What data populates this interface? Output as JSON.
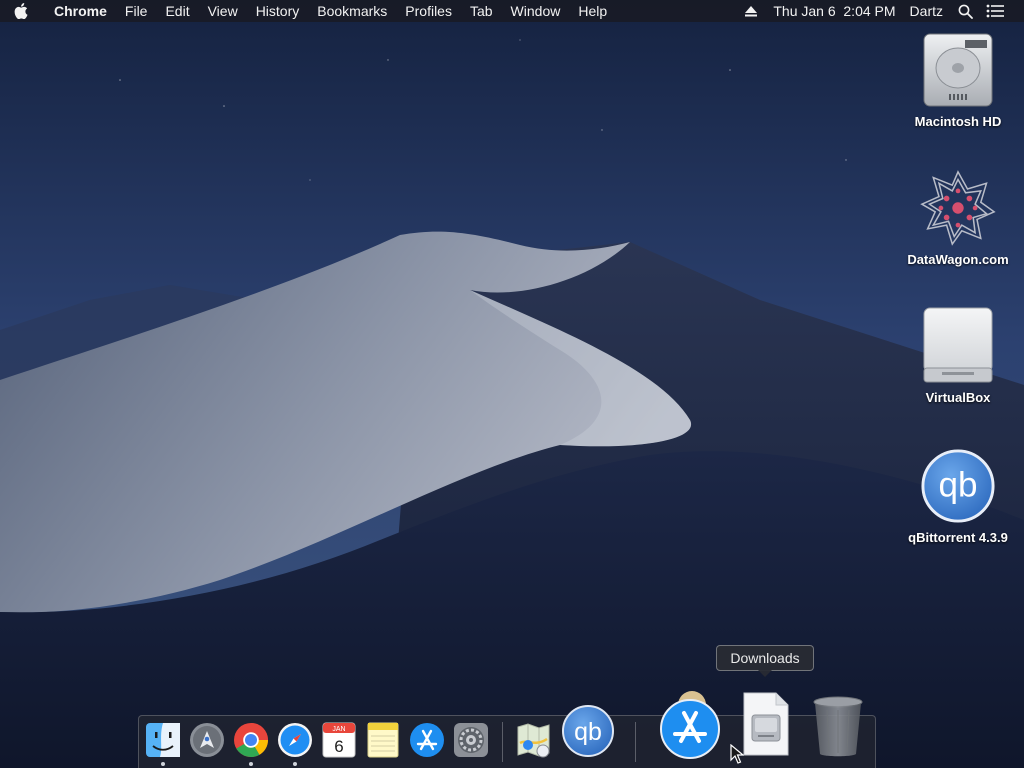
{
  "menubar": {
    "apple_icon": "apple-logo-icon",
    "app_name": "Chrome",
    "menus": [
      "File",
      "Edit",
      "View",
      "History",
      "Bookmarks",
      "Profiles",
      "Tab",
      "Window",
      "Help"
    ],
    "clock": "Thu Jan 6  2:04 PM",
    "user": "Dartz",
    "status_icons": [
      "eject-icon",
      "spotlight-search-icon",
      "notification-center-icon"
    ]
  },
  "desktop": {
    "icons": [
      {
        "label": "Macintosh HD",
        "icon": "hard-drive-icon"
      },
      {
        "label": "DataWagon.com",
        "icon": "datawagon-star-icon"
      },
      {
        "label": "VirtualBox",
        "icon": "external-disk-icon"
      },
      {
        "label": "qBittorrent 4.3.9",
        "icon": "qbittorrent-icon",
        "glyph": "qb"
      }
    ]
  },
  "dock": {
    "apps": [
      {
        "name": "Finder",
        "icon": "finder-icon",
        "running": true
      },
      {
        "name": "Launchpad",
        "icon": "launchpad-icon",
        "running": false
      },
      {
        "name": "Google Chrome",
        "icon": "chrome-icon",
        "running": true
      },
      {
        "name": "Safari",
        "icon": "safari-icon",
        "running": true
      },
      {
        "name": "Calendar",
        "icon": "calendar-icon",
        "running": false,
        "month": "JAN",
        "day": "6"
      },
      {
        "name": "Notes",
        "icon": "notes-icon",
        "running": false
      },
      {
        "name": "App Store",
        "icon": "app-store-icon",
        "running": false
      },
      {
        "name": "System Preferences",
        "icon": "system-preferences-icon",
        "running": false
      },
      {
        "name": "Maps",
        "icon": "maps-icon",
        "running": false
      },
      {
        "name": "qBittorrent",
        "icon": "qbittorrent-icon",
        "running": false,
        "glyph": "qb"
      }
    ],
    "others": [
      {
        "name": "Applications",
        "icon": "applications-stack-icon"
      },
      {
        "name": "Downloads",
        "icon": "downloads-stack-icon"
      },
      {
        "name": "Trash",
        "icon": "trash-icon"
      }
    ],
    "tooltip": "Downloads"
  },
  "colors": {
    "menubar": "#181a22",
    "sky_top": "#16233f",
    "sky_bottom": "#3d5680",
    "qb_blue": "#3f7fd0",
    "appstore_blue": "#1e8ef0"
  }
}
